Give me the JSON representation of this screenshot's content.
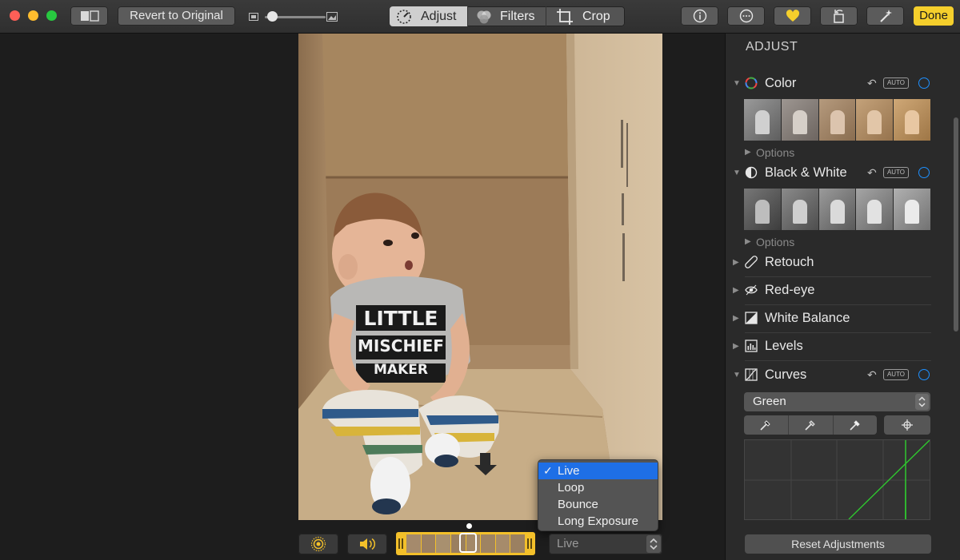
{
  "toolbar": {
    "revert_label": "Revert to Original",
    "tabs": [
      {
        "label": "Adjust",
        "active": true
      },
      {
        "label": "Filters",
        "active": false
      },
      {
        "label": "Crop",
        "active": false
      }
    ],
    "done_label": "Done",
    "zoom_level": 0.05
  },
  "panel": {
    "header": "ADJUST",
    "sections": [
      {
        "label": "Color",
        "expanded": true,
        "auto_label": "AUTO",
        "options_label": "Options"
      },
      {
        "label": "Black & White",
        "expanded": true,
        "auto_label": "AUTO",
        "options_label": "Options"
      },
      {
        "label": "Retouch",
        "expanded": false
      },
      {
        "label": "Red-eye",
        "expanded": false
      },
      {
        "label": "White Balance",
        "expanded": false
      },
      {
        "label": "Levels",
        "expanded": false
      },
      {
        "label": "Curves",
        "expanded": true,
        "auto_label": "AUTO"
      }
    ],
    "curves_channel": "Green",
    "reset_label": "Reset Adjustments"
  },
  "photo": {
    "shirt_text": [
      "LITTLE",
      "MISCHIEF",
      "MAKER"
    ]
  },
  "live_menu": {
    "items": [
      {
        "label": "Live",
        "selected": true
      },
      {
        "label": "Loop",
        "selected": false
      },
      {
        "label": "Bounce",
        "selected": false
      },
      {
        "label": "Long Exposure",
        "selected": false
      }
    ],
    "current_value": "Live"
  },
  "colors": {
    "accent_blue": "#1e90ff",
    "done_yellow": "#f5cf2c",
    "filmstrip_yellow": "#f3c02a",
    "curve_green": "#2fc62f"
  }
}
